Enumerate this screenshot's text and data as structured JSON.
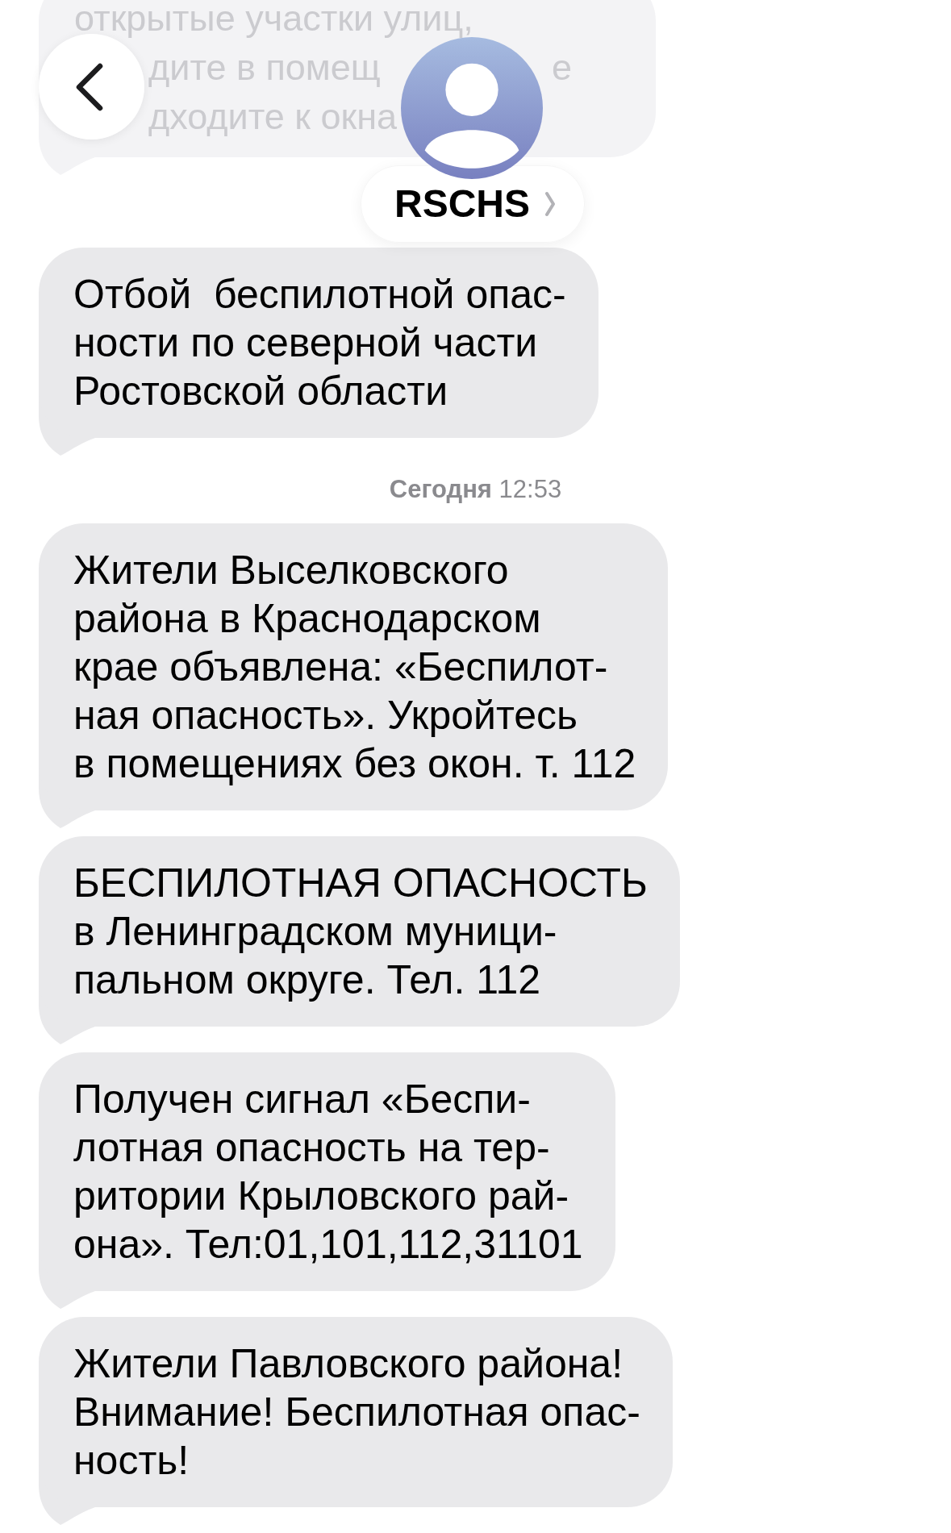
{
  "header": {
    "contact_name": "RSCHS"
  },
  "partly_hidden_message": {
    "lines": [
      {
        "parts": [
          "открытые участки улиц,"
        ]
      },
      {
        "parts": [
          "дите в помещ",
          "е"
        ]
      },
      {
        "parts": [
          "дходите к окна"
        ]
      }
    ]
  },
  "messages": [
    {
      "kind": "message",
      "text": "Отбой  беспилотной опас-\nности по северной части\nРостовской области"
    },
    {
      "kind": "timestamp",
      "text": "**Сегодня** 12:53"
    },
    {
      "kind": "message",
      "text": "Жители Выселковского\nрайона в Краснодарском\nкрае объявлена: «Беспилот-\nная опасность». Укройтесь\nв помещениях без окон. т. 112"
    },
    {
      "kind": "message",
      "text": "БЕСПИЛОТНАЯ ОПАСНОСТЬ\nв Ленинградском муници-\nпальном округе. Тел. 112"
    },
    {
      "kind": "message",
      "text": "Получен сигнал «Беспи-\nлотная опасность на тер-\nритории Крыловского рай-\nона». Тел:01,101,112,31101"
    },
    {
      "kind": "message",
      "text": "Жители Павловского района!\nВнимание! Беспилотная опас-\nность!"
    }
  ]
}
